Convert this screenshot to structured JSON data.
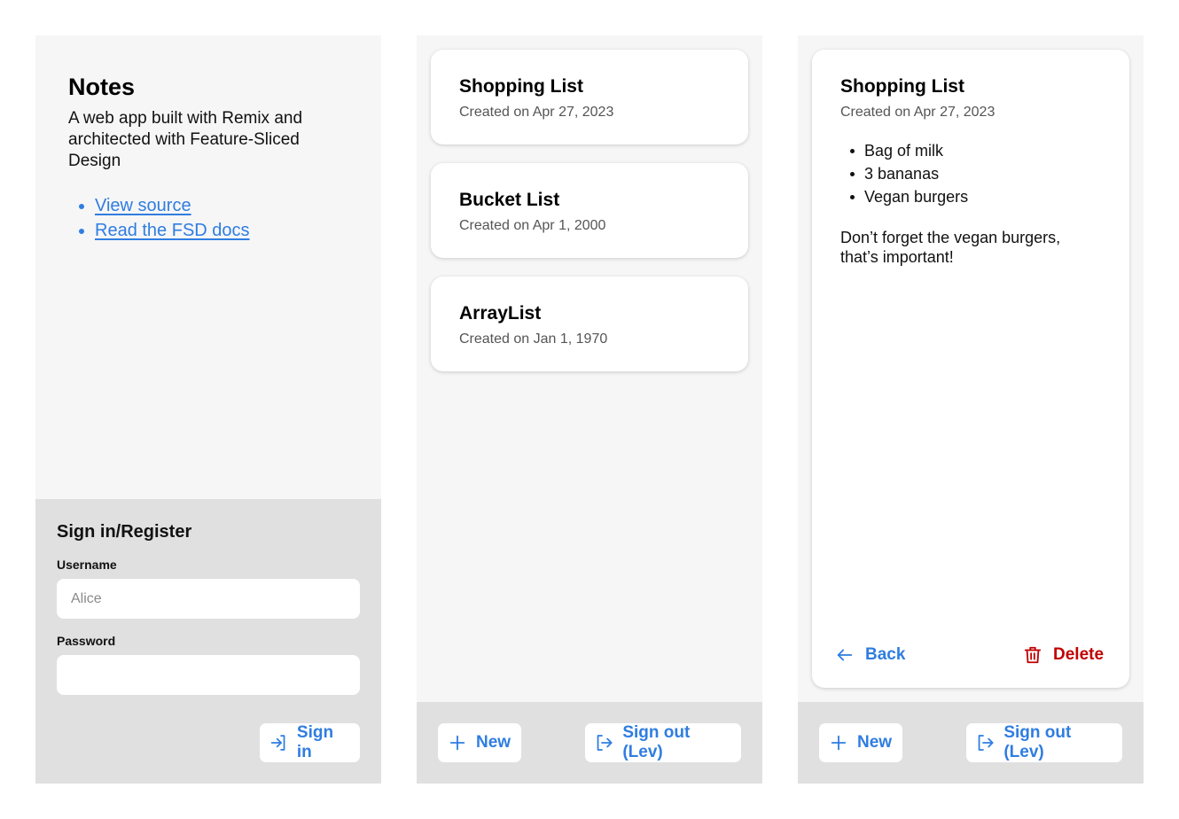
{
  "colors": {
    "accent": "#2f7de1",
    "danger": "#c00000",
    "panel_bg": "#f6f6f6",
    "bar_bg": "#e0e0e0"
  },
  "intro": {
    "title": "Notes",
    "description": "A web app built with Remix and architected with Feature-Sliced Design",
    "links": [
      {
        "label": "View source"
      },
      {
        "label": "Read the FSD docs"
      }
    ]
  },
  "signin": {
    "heading": "Sign in/Register",
    "username_label": "Username",
    "username_placeholder": "Alice",
    "username_value": "",
    "password_label": "Password",
    "password_value": "",
    "submit_label": "Sign in",
    "submit_icon": "login-icon"
  },
  "notes_list": {
    "notes": [
      {
        "title": "Shopping List",
        "date": "Created on Apr 27, 2023"
      },
      {
        "title": "Bucket List",
        "date": "Created on Apr 1, 2000"
      },
      {
        "title": "ArrayList",
        "date": "Created on Jan 1, 1970"
      }
    ]
  },
  "bottom_bar": {
    "new_label": "New",
    "new_icon": "plus-icon",
    "signout_label": "Sign out (Lev)",
    "signout_icon": "logout-icon"
  },
  "note_detail": {
    "title": "Shopping List",
    "date": "Created on Apr 27, 2023",
    "items": [
      "Bag of milk",
      "3 bananas",
      "Vegan burgers"
    ],
    "remark": "Don’t forget the vegan burgers, that’s important!",
    "back_label": "Back",
    "back_icon": "arrow-left-icon",
    "delete_label": "Delete",
    "delete_icon": "trash-icon"
  }
}
